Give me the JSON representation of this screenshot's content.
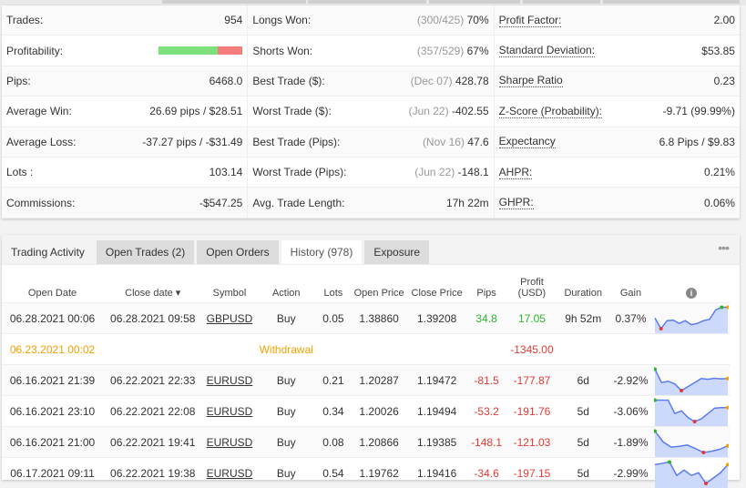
{
  "stats": {
    "col1": [
      {
        "label": "Trades:",
        "value": "954"
      },
      {
        "label": "Profitability:",
        "profitability_win_fraction": 0.7
      },
      {
        "label": "Pips:",
        "value": "6468.0"
      },
      {
        "label": "Average Win:",
        "value": "26.69 pips / $28.51"
      },
      {
        "label": "Average Loss:",
        "value": "-37.27 pips / -$31.49"
      },
      {
        "label": "Lots :",
        "value": "103.14"
      },
      {
        "label": "Commissions:",
        "value": "-$547.25"
      }
    ],
    "col2": [
      {
        "label": "Longs Won:",
        "note": "(300/425)",
        "value": "70%"
      },
      {
        "label": "Shorts Won:",
        "note": "(357/529)",
        "value": "67%"
      },
      {
        "label": "Best Trade ($):",
        "note": "(Dec 07)",
        "value": "428.78"
      },
      {
        "label": "Worst Trade ($):",
        "note": "(Jun 22)",
        "value": "-402.55"
      },
      {
        "label": "Best Trade (Pips):",
        "note": "(Nov 16)",
        "value": "47.6"
      },
      {
        "label": "Worst Trade (Pips):",
        "note": "(Jun 22)",
        "value": "-148.1"
      },
      {
        "label": "Avg. Trade Length:",
        "note": "",
        "value": "17h 22m"
      }
    ],
    "col3": [
      {
        "label": "Profit Factor:",
        "value": "2.00"
      },
      {
        "label": "Standard Deviation:",
        "value": "$53.85"
      },
      {
        "label": "Sharpe Ratio",
        "value": "0.23"
      },
      {
        "label": "Z-Score (Probability):",
        "value": "-9.71 (99.99%)"
      },
      {
        "label": "Expectancy",
        "value": "6.8 Pips / $9.83"
      },
      {
        "label": "AHPR:",
        "value": "0.21%"
      },
      {
        "label": "GHPR:",
        "value": "0.06%"
      }
    ]
  },
  "tabs": [
    {
      "label": "Trading Activity"
    },
    {
      "label": "Open Trades (2)"
    },
    {
      "label": "Open Orders"
    },
    {
      "label": "History (978)"
    },
    {
      "label": "Exposure"
    }
  ],
  "more": "•••",
  "columns": {
    "open_date": "Open Date",
    "close_date": "Close date ▾",
    "symbol": "Symbol",
    "action": "Action",
    "lots": "Lots",
    "open_price": "Open Price",
    "close_price": "Close Price",
    "pips": "Pips",
    "profit1": "Profit",
    "profit2": "(USD)",
    "duration": "Duration",
    "gain": "Gain",
    "info": "i"
  },
  "rows": [
    {
      "open": "06.28.2021 00:06",
      "close": "06.28.2021 09:58",
      "symbol": "GBPUSD",
      "action": "Buy",
      "lots": "0.05",
      "op": "1.38860",
      "cp": "1.39208",
      "pips": "34.8",
      "profit": "17.05",
      "duration": "9h 52m",
      "gain": "0.37%",
      "positive": true,
      "spark": [
        5,
        1,
        4,
        4.2,
        3,
        4,
        2.5,
        3,
        4,
        4.5,
        8,
        9,
        9
      ]
    },
    {
      "open": "06.23.2021 00:02",
      "action": "Withdrawal",
      "profit": "-1345.00",
      "withdrawal": true
    },
    {
      "open": "06.16.2021 21:39",
      "close": "06.22.2021 22:33",
      "symbol": "EURUSD",
      "action": "Buy",
      "lots": "0.21",
      "op": "1.20287",
      "cp": "1.19472",
      "pips": "-81.5",
      "profit": "-177.87",
      "duration": "6d",
      "gain": "-2.92%",
      "positive": false,
      "spark": [
        9,
        4,
        4.5,
        3.5,
        1,
        2.5,
        4,
        5.5,
        5.2,
        5.6,
        5.4,
        5.5
      ]
    },
    {
      "open": "06.16.2021 23:10",
      "close": "06.22.2021 22:08",
      "symbol": "EURUSD",
      "action": "Buy",
      "lots": "0.34",
      "op": "1.20026",
      "cp": "1.19494",
      "pips": "-53.2",
      "profit": "-191.76",
      "duration": "5d",
      "gain": "-3.06%",
      "positive": false,
      "spark": [
        9,
        9,
        9,
        4,
        5,
        2.5,
        1,
        2,
        4,
        6,
        6.2,
        6.2
      ]
    },
    {
      "open": "06.16.2021 21:00",
      "close": "06.22.2021 19:41",
      "symbol": "EURUSD",
      "action": "Buy",
      "lots": "0.08",
      "op": "1.20866",
      "cp": "1.19385",
      "pips": "-148.1",
      "profit": "-121.03",
      "duration": "5d",
      "gain": "-1.89%",
      "positive": false,
      "spark": [
        9,
        5,
        3,
        3.3,
        3.8,
        2.5,
        1,
        1.5,
        2.2,
        3.5
      ]
    },
    {
      "open": "06.17.2021 09:11",
      "close": "06.22.2021 19:38",
      "symbol": "EURUSD",
      "action": "Buy",
      "lots": "0.54",
      "op": "1.19762",
      "cp": "1.19416",
      "pips": "-34.6",
      "profit": "-197.15",
      "duration": "5d",
      "gain": "-2.99%",
      "positive": false,
      "spark": [
        8,
        8.5,
        9,
        4,
        6,
        4,
        5,
        1,
        3,
        5,
        8
      ]
    }
  ]
}
